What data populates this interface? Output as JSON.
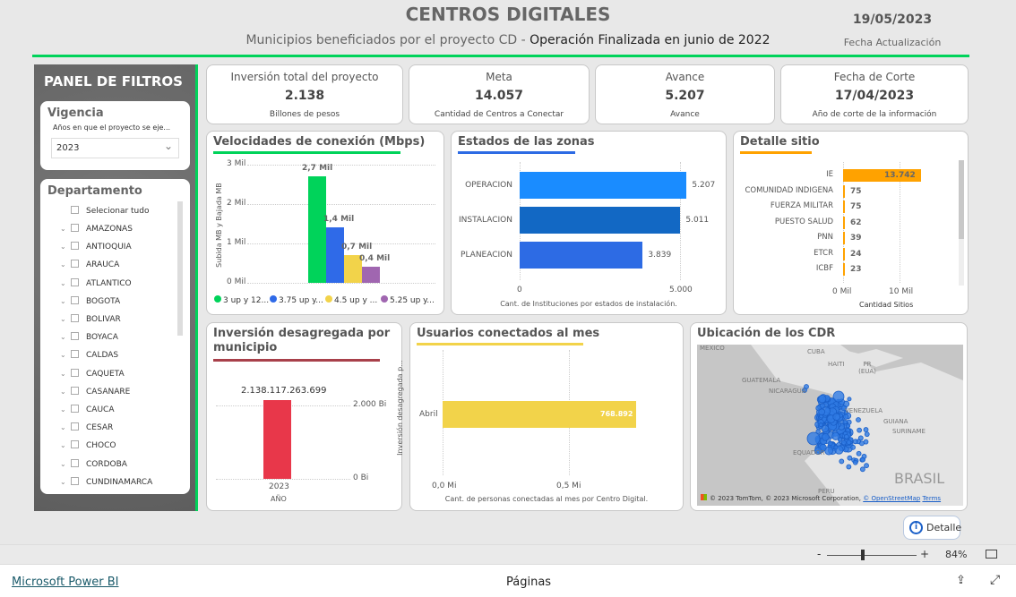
{
  "header": {
    "title": "CENTROS DIGITALES",
    "subtitle_a": "Municipios beneficiados por el proyecto CD - ",
    "subtitle_b": "Operación Finalizada en junio de 2022",
    "date": "19/05/2023",
    "date_label": "Fecha Actualización"
  },
  "filters": {
    "title": "PANEL DE FILTROS",
    "vigencia": {
      "title": "Vigencia",
      "desc": "Años en que el proyecto se eje...",
      "value": "2023"
    },
    "departamento": {
      "title": "Departamento",
      "select_all": "Selecionar tudo",
      "items": [
        "AMAZONAS",
        "ANTIOQUIA",
        "ARAUCA",
        "ATLANTICO",
        "BOGOTA",
        "BOLIVAR",
        "BOYACA",
        "CALDAS",
        "CAQUETA",
        "CASANARE",
        "CAUCA",
        "CESAR",
        "CHOCO",
        "CORDOBA",
        "CUNDINAMARCA"
      ]
    }
  },
  "kpis": [
    {
      "label": "Inversión total del proyecto",
      "value": "2.138",
      "sub": "Billones de pesos"
    },
    {
      "label": "Meta",
      "value": "14.057",
      "sub": "Cantidad de Centros a Conectar"
    },
    {
      "label": "Avance",
      "value": "5.207",
      "sub": "Avance"
    },
    {
      "label": "Fecha de Corte",
      "value": "17/04/2023",
      "sub": "Año de corte de la información"
    }
  ],
  "chart_data": [
    {
      "type": "bar",
      "title": "Velocidades de conexión (Mbps)",
      "ylabel": "Subida MB y Bajada MB",
      "ylim": [
        0,
        3000
      ],
      "yticks": [
        "0 Mil",
        "1 Mil",
        "2 Mil",
        "3 Mil"
      ],
      "series": [
        {
          "name": "3 up y 12...",
          "values": [
            2700
          ],
          "label": "2,7 Mil",
          "color": "#00d35a"
        },
        {
          "name": "3.75 up y...",
          "values": [
            1400
          ],
          "label": "1,4 Mil",
          "color": "#2f6ae8"
        },
        {
          "name": "4.5 up y ...",
          "values": [
            700
          ],
          "label": "0,7 Mil",
          "color": "#f2d34a"
        },
        {
          "name": "5.25 up y...",
          "values": [
            400
          ],
          "label": "0,4 Mil",
          "color": "#a066b0"
        }
      ],
      "legend": "bottom"
    },
    {
      "type": "bar",
      "orientation": "horizontal",
      "title": "Estados de las zonas",
      "categories": [
        "OPERACION",
        "INSTALACION",
        "PLANEACION"
      ],
      "values": [
        5207,
        5011,
        3839
      ],
      "labels": [
        "5.207",
        "5.011",
        "3.839"
      ],
      "colors": [
        "#1a8cff",
        "#1268c4",
        "#2d6be4"
      ],
      "xlim": [
        0,
        5000
      ],
      "xticks": [
        "0",
        "5.000"
      ],
      "xlabel": "Cant. de Instituciones por estados de instalación."
    },
    {
      "type": "bar",
      "orientation": "horizontal",
      "title": "Detalle sitio",
      "categories": [
        "IE",
        "COMUNIDAD INDIGENA",
        "FUERZA MILITAR",
        "PUESTO SALUD",
        "PNN",
        "ETCR",
        "ICBF"
      ],
      "values": [
        13742,
        75,
        75,
        62,
        39,
        24,
        23
      ],
      "labels": [
        "13.742",
        "75",
        "75",
        "62",
        "39",
        "24",
        "23"
      ],
      "color": "#ffa200",
      "xticks": [
        "0 Mil",
        "10 Mil"
      ],
      "xlabel": "Cantidad Sitios"
    },
    {
      "type": "bar",
      "title": "Inversión desagregada por municipio",
      "categories": [
        "2023"
      ],
      "values": [
        2138117263699
      ],
      "label": "2.138.117.263.699",
      "color": "#e8374a",
      "yticks": [
        "0 Bi",
        "2.000 Bi"
      ],
      "xlabel": "AÑO",
      "ylabel": "Inversión desagregada p..."
    },
    {
      "type": "bar",
      "orientation": "horizontal",
      "title": "Usuarios conectados al mes",
      "categories": [
        "Abril"
      ],
      "values": [
        768892
      ],
      "label": "768.892",
      "color": "#f2d34a",
      "xticks": [
        "0,0 Mi",
        "0,5 Mi"
      ],
      "xlabel": "Cant. de personas conectadas al mes por Centro Digital."
    }
  ],
  "map": {
    "title": "Ubicación de los CDR",
    "labels": [
      "MEXICO",
      "CUBA",
      "HAITI",
      "PR (EUA)",
      "GUATEMALA",
      "NICARAGUA",
      "VENEZUELA",
      "GUIANA",
      "SURINAME",
      "EQUADOR",
      "BRASIL",
      "PERU"
    ],
    "attribution": "© 2023 TomTom, © 2023 Microsoft Corporation, ",
    "osm": "© OpenStreetMap",
    "terms": "Terms"
  },
  "detalle_button": "Detalle",
  "zoom": {
    "value": "84%",
    "minus": "-",
    "plus": "+"
  },
  "footer": {
    "brand": "Microsoft Power BI",
    "pages": "Páginas"
  },
  "colors": {
    "accent_green": "#00d35a",
    "panel": "#666666"
  }
}
